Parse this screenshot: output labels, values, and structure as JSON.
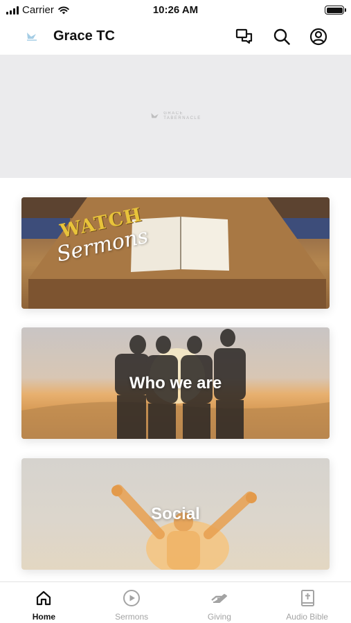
{
  "status_bar": {
    "carrier": "Carrier",
    "time": "10:26 AM"
  },
  "header": {
    "title": "Grace TC",
    "logo_icon": "dove-icon",
    "actions": [
      "chat-icon",
      "search-icon",
      "profile-icon"
    ]
  },
  "banner": {
    "logo_text_line1": "GRACE",
    "logo_text_line2": "TABERNACLE"
  },
  "cards": {
    "sermons": {
      "line1": "WATCH",
      "line2": "Sermons"
    },
    "who": {
      "title": "Who we are"
    },
    "social": {
      "title": "Social"
    }
  },
  "nav": {
    "items": [
      {
        "label": "Home",
        "icon": "home-icon",
        "active": true
      },
      {
        "label": "Sermons",
        "icon": "play-circle-icon",
        "active": false
      },
      {
        "label": "Giving",
        "icon": "giving-hand-icon",
        "active": false
      },
      {
        "label": "Audio Bible",
        "icon": "bible-icon",
        "active": false
      }
    ]
  },
  "colors": {
    "accent_active": "#111111",
    "inactive": "#a3a3a3",
    "banner_bg": "#ebebed"
  }
}
